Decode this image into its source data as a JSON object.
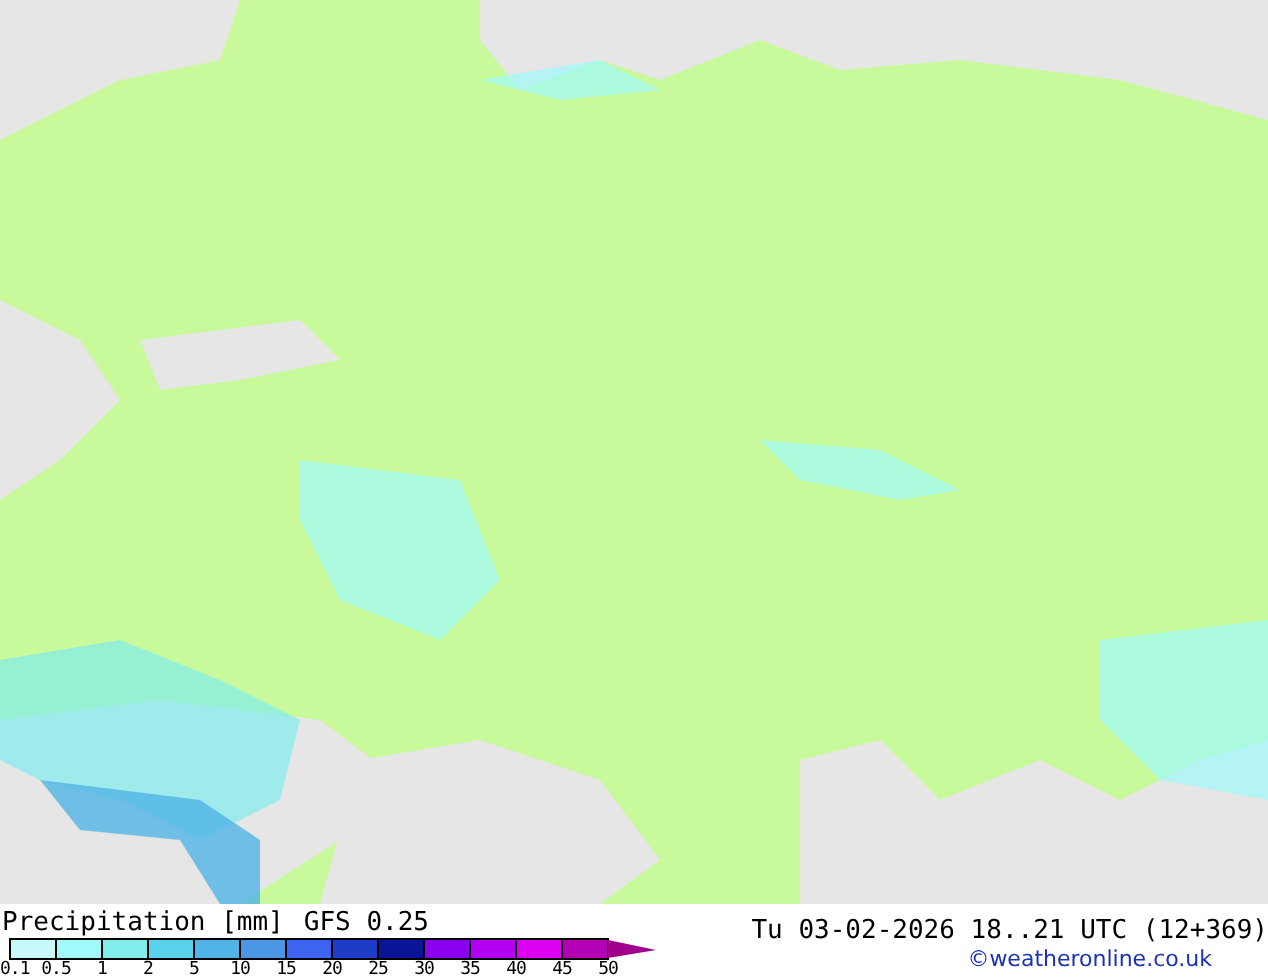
{
  "title": "Precipitation [mm]",
  "model": "GFS 0.25",
  "valid_time": "Tu 03-02-2026 18..21 UTC (12+369)",
  "copyright": "©weatheronline.co.uk",
  "legend": {
    "bins": [
      {
        "color": "#c8fafa"
      },
      {
        "color": "#a0fafa"
      },
      {
        "color": "#80ecec"
      },
      {
        "color": "#5ad2ec"
      },
      {
        "color": "#50b4e6"
      },
      {
        "color": "#4c96e6"
      },
      {
        "color": "#3c64f0"
      },
      {
        "color": "#1e3cc8"
      },
      {
        "color": "#0a1496"
      },
      {
        "color": "#8c00f0"
      },
      {
        "color": "#b400f0"
      },
      {
        "color": "#dc00f0"
      },
      {
        "color": "#b400b4"
      }
    ],
    "ticks": [
      "0.1",
      "0.5",
      "1",
      "2",
      "5",
      "10",
      "15",
      "20",
      "25",
      "30",
      "35",
      "40",
      "45",
      "50"
    ]
  }
}
